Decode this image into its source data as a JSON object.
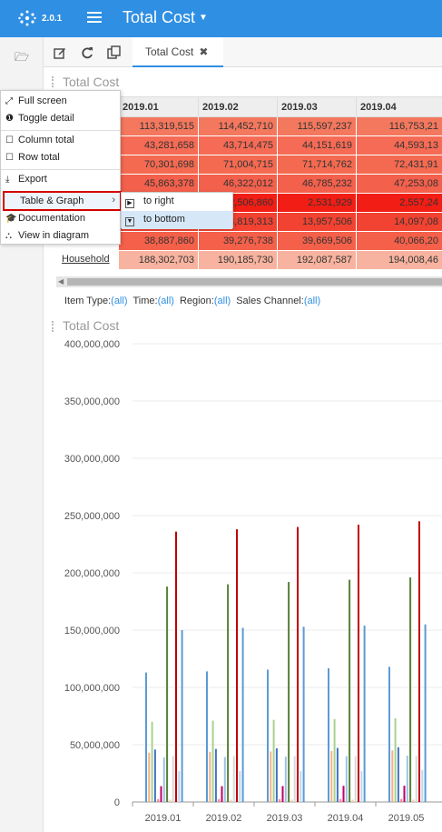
{
  "app": {
    "version": "2.0.1",
    "title": "Total Cost"
  },
  "tab": {
    "label": "Total Cost"
  },
  "table": {
    "title": "Total Cost",
    "columns": [
      "2019.01",
      "2019.02",
      "2019.03",
      "2019.04"
    ],
    "rows": [
      {
        "label": "",
        "cells": [
          "113,319,515",
          "114,452,710",
          "115,597,237",
          "116,753,21"
        ],
        "colors": [
          "#f3785e",
          "#f3785e",
          "#f3785e",
          "#f3785e"
        ]
      },
      {
        "label": "",
        "cells": [
          "43,281,658",
          "43,714,475",
          "44,151,619",
          "44,593,13"
        ],
        "colors": [
          "#f56b55",
          "#f56b55",
          "#f56b55",
          "#f56b55"
        ]
      },
      {
        "label": "",
        "cells": [
          "70,301,698",
          "71,004,715",
          "71,714,762",
          "72,431,91"
        ],
        "colors": [
          "#f46a51",
          "#f46a51",
          "#f46a51",
          "#f46a51"
        ]
      },
      {
        "label": "",
        "cells": [
          "45,863,378",
          "46,322,012",
          "46,785,232",
          "47,253,08"
        ],
        "colors": [
          "#f3604c",
          "#f3604c",
          "#f3604c",
          "#f3604c"
        ]
      },
      {
        "label": "",
        "cells": [
          "",
          "2,506,860",
          "2,531,929",
          "2,557,24"
        ],
        "colors": [
          "#f21d14",
          "#f21d14",
          "#f21d14",
          "#f21d14"
        ]
      },
      {
        "label": "",
        "cells": [
          "",
          "13,819,313",
          "13,957,506",
          "14,097,08"
        ],
        "colors": [
          "#f24231",
          "#f24231",
          "#f24231",
          "#f24231"
        ]
      },
      {
        "label": "",
        "cells": [
          "38,887,860",
          "39,276,738",
          "39,669,506",
          "40,066,20"
        ],
        "colors": [
          "#f4604a",
          "#f4604a",
          "#f4604a",
          "#f4604a"
        ]
      },
      {
        "label": "Household",
        "cells": [
          "188,302,703",
          "190,185,730",
          "192,087,587",
          "194,008,46"
        ],
        "colors": [
          "#f7b39f",
          "#f7b39f",
          "#f7b39f",
          "#f7b39f"
        ]
      }
    ]
  },
  "filters": [
    {
      "label": "Item Type:",
      "value": "(all)"
    },
    {
      "label": "Time:",
      "value": "(all)"
    },
    {
      "label": "Region:",
      "value": "(all)"
    },
    {
      "label": "Sales Channel:",
      "value": "(all)"
    }
  ],
  "context_menu": {
    "items": [
      "Full screen",
      "Toggle detail",
      "Column total",
      "Row total",
      "Export",
      "Table & Graph",
      "Documentation",
      "View in diagram"
    ],
    "submenu": [
      "to right",
      "to bottom"
    ]
  },
  "chart_data": {
    "type": "bar",
    "title": "Total Cost",
    "categories": [
      "2019.01",
      "2019.02",
      "2019.03",
      "2019.04",
      "2019.05"
    ],
    "ylim": [
      0,
      400000000
    ],
    "yticks": [
      "0",
      "50,000,000",
      "100,000,000",
      "150,000,000",
      "200,000,000",
      "250,000,000",
      "300,000,000",
      "350,000,000",
      "400,000,000"
    ],
    "series": [
      {
        "color": "#5b9bd5",
        "values": [
          113000000,
          114000000,
          115500000,
          116700000,
          118000000
        ]
      },
      {
        "color": "#f4b183",
        "values": [
          43000000,
          43700000,
          44100000,
          44500000,
          45000000
        ]
      },
      {
        "color": "#a9d18e",
        "values": [
          70000000,
          71000000,
          71700000,
          72400000,
          73000000
        ]
      },
      {
        "color": "#4472c4",
        "values": [
          45800000,
          46300000,
          46800000,
          47200000,
          47700000
        ]
      },
      {
        "color": "#ff7c80",
        "values": [
          2500000,
          2500000,
          2500000,
          2550000,
          2600000
        ]
      },
      {
        "color": "#c00066",
        "values": [
          13800000,
          13800000,
          13900000,
          14100000,
          14200000
        ]
      },
      {
        "color": "#9dc3e6",
        "values": [
          38800000,
          39200000,
          39600000,
          40000000,
          40400000
        ]
      },
      {
        "color": "#548235",
        "values": [
          188000000,
          190000000,
          192000000,
          194000000,
          196000000
        ]
      },
      {
        "color": "#f8cbad",
        "values": [
          2000000,
          2000000,
          2000000,
          2000000,
          2000000
        ]
      },
      {
        "color": "#d9d9d9",
        "values": [
          40000000,
          40000000,
          40000000,
          40000000,
          40000000
        ]
      },
      {
        "color": "#c00000",
        "values": [
          236000000,
          238000000,
          240000000,
          242000000,
          245000000
        ]
      },
      {
        "color": "#bdd7ee",
        "values": [
          27000000,
          27000000,
          27000000,
          27000000,
          28000000
        ]
      },
      {
        "color": "#5b9bd5",
        "values": [
          150000000,
          152000000,
          153000000,
          154000000,
          155000000
        ]
      }
    ]
  }
}
